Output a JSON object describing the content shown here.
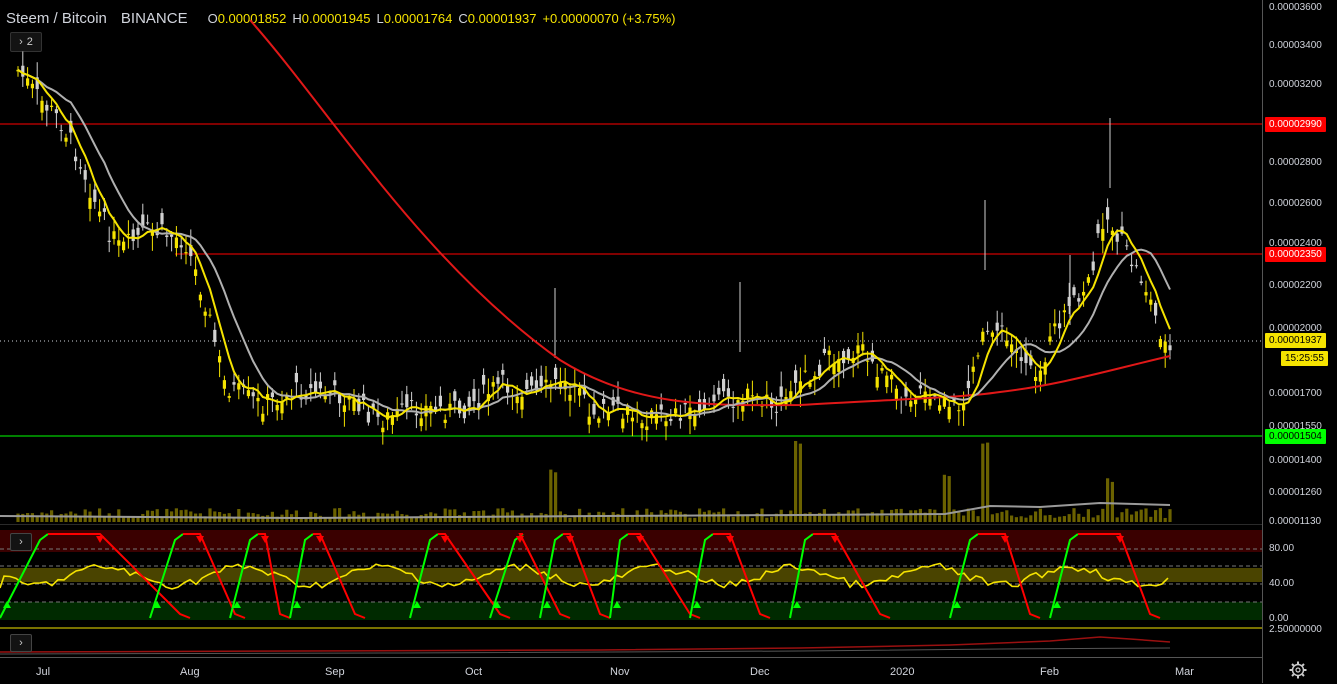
{
  "header": {
    "symbol": "Steem / Bitcoin",
    "exchange": "BINANCE",
    "open_label": "O",
    "open": "0.00001852",
    "high_label": "H",
    "high": "0.00001945",
    "low_label": "L",
    "low": "0.00001764",
    "close_label": "C",
    "close": "0.00001937",
    "change": "+0.00000070 (+3.75%)"
  },
  "layers_button": {
    "icon": "chevron-right-icon",
    "count": "2"
  },
  "price_scale": {
    "ticks": [
      "0.00003600",
      "0.00003400",
      "0.00003200",
      "0.00002800",
      "0.00002600",
      "0.00002400",
      "0.00002200",
      "0.00002000",
      "0.00001700",
      "0.00001550",
      "0.00001400",
      "0.00001260",
      "0.00001130"
    ],
    "tags": {
      "resistance_high": "0.00002990",
      "resistance_mid": "0.00002350",
      "current_price": "0.00001937",
      "countdown": "15:25:55",
      "support": "0.00001504"
    },
    "colors": {
      "resistance": "#ff0000",
      "current": "#f5e300",
      "support": "#00ff00"
    }
  },
  "oscillator": {
    "ticks": [
      "80.00",
      "40.00",
      "0.00"
    ],
    "lower_pane_tick": "2.50000000"
  },
  "time_axis": {
    "labels": [
      "Jul",
      "Aug",
      "Sep",
      "Oct",
      "Nov",
      "Dec",
      "2020",
      "Feb",
      "Mar"
    ]
  },
  "settings_icon": "gear-icon",
  "colors": {
    "up_candle": "#f5e300",
    "down_candle": "#d0d0d0",
    "ma_fast": "#f5e300",
    "ma_mid": "#b0b0b0",
    "ma_slow": "#e01818",
    "stoch_k_up": "#00ff00",
    "stoch_k_down": "#ff0000",
    "stoch_d": "#f5e300"
  }
}
